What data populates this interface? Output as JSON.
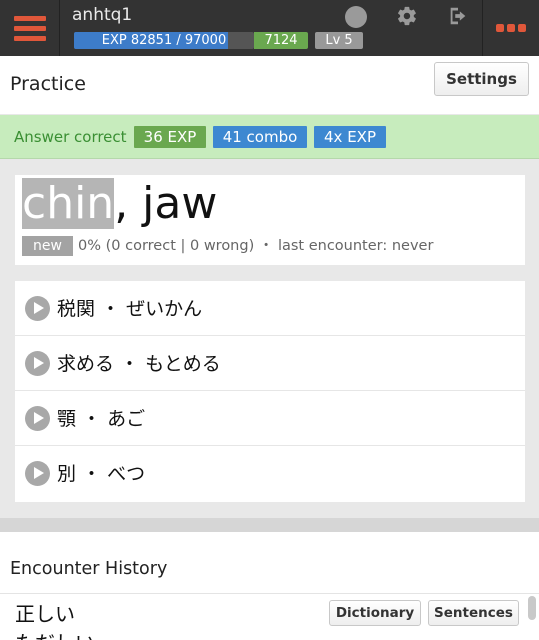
{
  "topbar": {
    "username": "anhtq1",
    "exp_text": "EXP 82851 / 97000",
    "exp_fraction": 0.854,
    "exp_badge": "7124",
    "level": "Lv 5",
    "icons": [
      "hamburger-menu-icon",
      "status-circle-icon",
      "gear-icon",
      "sign-out-icon",
      "more-icon"
    ],
    "accent_color": "#e0573a"
  },
  "practice": {
    "title": "Practice",
    "settings_label": "Settings"
  },
  "answer": {
    "message": "Answer correct",
    "exp": "36 EXP",
    "combo": "41 combo",
    "multiplier": "4x EXP"
  },
  "word": {
    "highlight": "chin",
    "rest": ", jaw",
    "badge": "new",
    "stats": "0% (0 correct | 0 wrong) ・ last encounter: never"
  },
  "options": [
    {
      "label": "税関 ・ ぜいかん"
    },
    {
      "label": "求める ・ もとめる"
    },
    {
      "label": "顎 ・ あご"
    },
    {
      "label": "別 ・ べつ"
    }
  ],
  "history": {
    "title": "Encounter History",
    "word": "正しい",
    "word_reading_partial": "ただしい",
    "dictionary_label": "Dictionary",
    "sentences_label": "Sentences"
  }
}
